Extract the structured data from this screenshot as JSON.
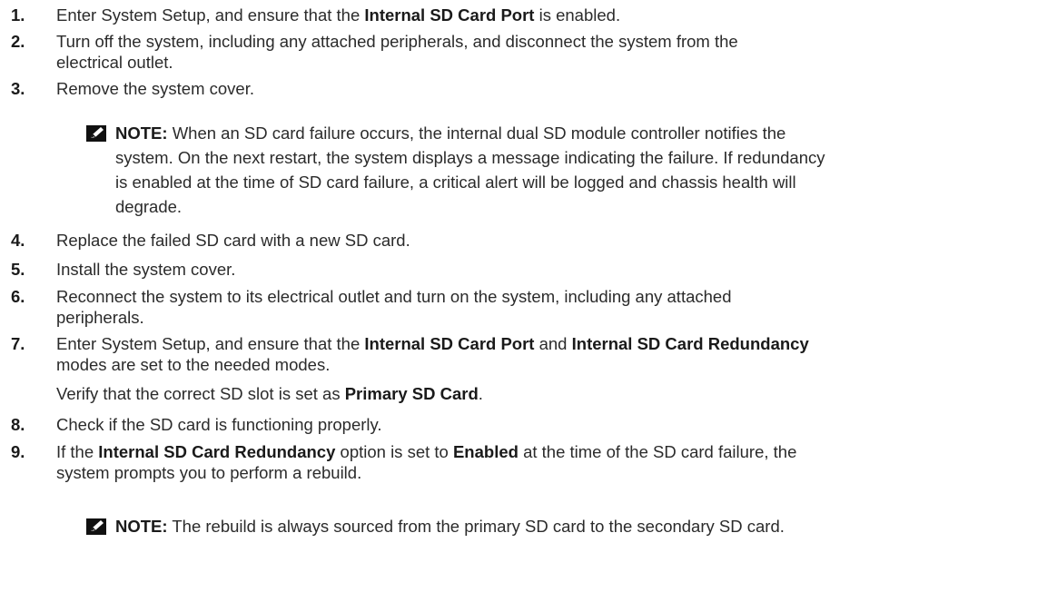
{
  "steps": [
    {
      "n": "1.",
      "parts": [
        "Enter System Setup, and ensure that the ",
        "Internal SD Card Port",
        " is enabled."
      ]
    },
    {
      "n": "2.",
      "lines": [
        "Turn off the system, including any attached peripherals, and disconnect the system from the",
        "electrical outlet."
      ]
    },
    {
      "n": "3.",
      "text": "Remove the system cover."
    },
    {
      "n": "4.",
      "text": "Replace the failed SD card with a new SD card."
    },
    {
      "n": "5.",
      "text": "Install the system cover."
    },
    {
      "n": "6.",
      "lines": [
        "Reconnect the system to its electrical outlet and turn on the system, including any attached",
        "peripherals."
      ]
    },
    {
      "n": "7.",
      "parts": [
        "Enter System Setup, and ensure that the ",
        "Internal SD Card Port",
        " and ",
        "Internal SD Card Redundancy"
      ],
      "line2": "modes are set to the needed modes."
    },
    {
      "n": "8.",
      "text": "Check if the SD card is functioning properly."
    },
    {
      "n": "9.",
      "parts": [
        "If the ",
        "Internal SD Card Redundancy",
        " option is set to ",
        "Enabled",
        " at the time of the SD card failure, the"
      ],
      "line2": "system prompts you to perform a rebuild."
    }
  ],
  "step7_sub": {
    "parts": [
      "Verify that the correct SD slot is set as ",
      "Primary SD Card",
      "."
    ]
  },
  "note1": {
    "label": "NOTE:",
    "lines": [
      " When an SD card failure occurs, the internal dual SD module controller notifies the",
      "system. On the next restart, the system displays a message indicating the failure. If redundancy",
      "is enabled at the time of SD card failure, a critical alert will be logged and chassis health will",
      "degrade."
    ]
  },
  "note2": {
    "label": "NOTE:",
    "text": " The rebuild is always sourced from the primary SD card to the secondary SD card."
  },
  "icons": {
    "note": "pencil-note-icon"
  }
}
